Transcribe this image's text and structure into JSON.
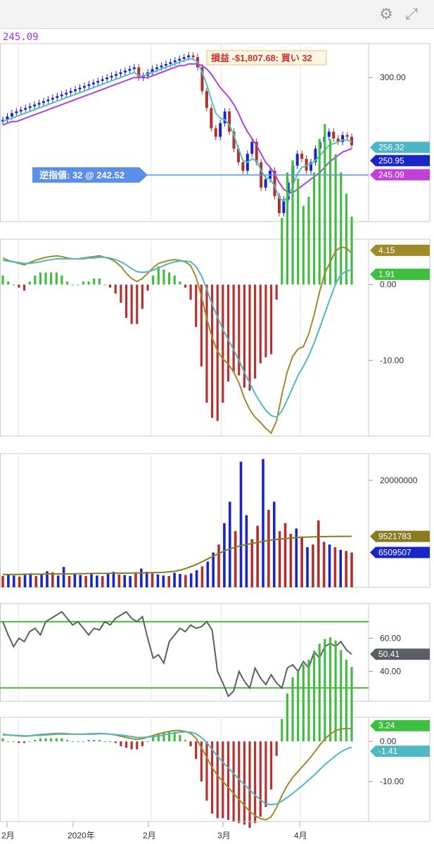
{
  "toolbar": {
    "settings_icon": "gear-icon",
    "expand_icon": "expand-icon"
  },
  "chart_data": [
    {
      "type": "candlestick",
      "panel": "price",
      "top_price_label": "245.09",
      "axis_ticks": [
        "300.00"
      ],
      "price_tags": [
        {
          "text": "256.32",
          "color": "#4db6c6",
          "value": 256.32
        },
        {
          "text": "250.95",
          "color": "#1a25c8",
          "value": 250.95
        },
        {
          "text": "245.09",
          "color": "#c040d8",
          "value": 245.09
        }
      ],
      "pnl_label": "損益 -$1,807.68: 買い 32",
      "stop_order": {
        "text": "逆指値: 32 @ 242.52",
        "value": 242.52
      },
      "ylim": [
        215,
        320
      ],
      "close": [
        275,
        277,
        279,
        280,
        281,
        282,
        283,
        284,
        285,
        286,
        287,
        288,
        289,
        290,
        291,
        292,
        293,
        294,
        295,
        296,
        297,
        298,
        299,
        300,
        301,
        302,
        303,
        304,
        305,
        306,
        300,
        301,
        303,
        305,
        306,
        307,
        308,
        309,
        310,
        311,
        312,
        313,
        312,
        306,
        292,
        282,
        270,
        265,
        273,
        280,
        268,
        258,
        250,
        245,
        255,
        262,
        250,
        235,
        240,
        245,
        230,
        220,
        228,
        238,
        248,
        255,
        252,
        245,
        250,
        258,
        262,
        265,
        268,
        264,
        262,
        266,
        265,
        260
      ],
      "series": [
        {
          "name": "MA short",
          "color": "#55c0c2",
          "values": [
            274,
            275,
            276,
            277,
            278,
            279,
            280,
            281,
            282,
            283,
            284,
            285,
            286,
            287,
            288,
            289,
            290,
            291,
            292,
            293,
            294,
            295,
            296,
            297,
            298,
            299,
            300,
            301,
            302,
            303,
            301,
            301,
            302,
            303,
            304,
            305,
            306,
            307,
            308,
            309,
            310,
            311,
            311,
            309,
            303,
            296,
            287,
            279,
            276,
            275,
            272,
            266,
            258,
            251,
            250,
            252,
            251,
            245,
            241,
            240,
            236,
            229,
            227,
            230,
            236,
            243,
            247,
            248,
            249,
            251,
            254,
            257,
            260,
            261,
            262,
            263,
            263,
            262
          ]
        },
        {
          "name": "MA long",
          "color": "#b040e0",
          "values": [
            272,
            273,
            274,
            274,
            275,
            276,
            277,
            278,
            279,
            280,
            281,
            282,
            283,
            284,
            285,
            286,
            287,
            288,
            289,
            290,
            291,
            292,
            293,
            294,
            295,
            296,
            297,
            298,
            299,
            300,
            300,
            300,
            300,
            301,
            302,
            303,
            304,
            305,
            306,
            307,
            307,
            308,
            308,
            308,
            307,
            305,
            302,
            298,
            294,
            291,
            288,
            284,
            279,
            273,
            268,
            264,
            260,
            255,
            250,
            247,
            243,
            238,
            234,
            232,
            232,
            234,
            236,
            238,
            240,
            242,
            244,
            247,
            250,
            252,
            254,
            256,
            257,
            258
          ]
        }
      ]
    },
    {
      "type": "histogram+line",
      "panel": "macd",
      "axis_ticks": [
        "0.00",
        "-10.00"
      ],
      "tags": [
        {
          "text": "4.15",
          "color": "#a08a2a",
          "value": 4.15
        },
        {
          "text": "1.91",
          "color": "#3fbf3f",
          "value": 1.91
        }
      ],
      "ylim": [
        -20,
        6
      ],
      "series": [
        {
          "name": "MACD",
          "color": "#a08a2a",
          "values": [
            3.5,
            3.2,
            3.0,
            2.8,
            2.6,
            2.9,
            3.2,
            3.4,
            3.6,
            3.7,
            3.8,
            3.7,
            3.5,
            3.4,
            3.4,
            3.5,
            3.6,
            3.7,
            3.8,
            3.6,
            3.4,
            3.0,
            2.4,
            1.5,
            0.8,
            0.4,
            0.8,
            1.5,
            2.2,
            2.8,
            3.0,
            3.2,
            3.3,
            3.2,
            3.0,
            2.5,
            1.0,
            -1.5,
            -4.5,
            -7.0,
            -8.8,
            -9.8,
            -10.5,
            -11.5,
            -13.0,
            -15.0,
            -16.5,
            -17.5,
            -18.2,
            -19.0,
            -19.6,
            -18.0,
            -14.5,
            -11.5,
            -9.5,
            -8.5,
            -8.2,
            -6.5,
            -4.0,
            -1.0,
            1.5,
            3.0,
            4.4,
            5.0,
            4.8,
            4.15
          ]
        },
        {
          "name": "Signal",
          "color": "#4fb8c2",
          "values": [
            3.2,
            3.1,
            3.0,
            2.9,
            2.8,
            2.8,
            2.9,
            3.0,
            3.2,
            3.3,
            3.4,
            3.4,
            3.4,
            3.4,
            3.4,
            3.4,
            3.5,
            3.5,
            3.6,
            3.6,
            3.5,
            3.3,
            3.0,
            2.6,
            2.1,
            1.7,
            1.6,
            1.7,
            1.9,
            2.2,
            2.5,
            2.8,
            3.0,
            3.1,
            3.1,
            3.0,
            2.4,
            1.2,
            -0.6,
            -2.6,
            -4.3,
            -5.9,
            -7.3,
            -8.6,
            -10.0,
            -11.6,
            -13.0,
            -14.4,
            -15.6,
            -16.6,
            -17.3,
            -17.5,
            -16.7,
            -15.2,
            -13.6,
            -12.0,
            -10.8,
            -9.4,
            -7.7,
            -5.8,
            -3.8,
            -1.8,
            0.1,
            1.3,
            1.8,
            1.91
          ]
        }
      ]
    },
    {
      "type": "bar+line",
      "panel": "volume",
      "axis_ticks": [
        "20000000"
      ],
      "tags": [
        {
          "text": "9521783",
          "color": "#8a7a20",
          "value": 9521783
        },
        {
          "text": "6509507",
          "color": "#1a25c8",
          "value": 6509507
        }
      ],
      "ylim": [
        0,
        25000000
      ],
      "values": [
        2100000,
        2500000,
        2200000,
        2000000,
        2300000,
        2600000,
        2100000,
        2400000,
        3000000,
        2800000,
        2200000,
        3800000,
        2100000,
        2600000,
        2300000,
        2100000,
        2500000,
        2200000,
        2100000,
        2600000,
        2900000,
        2400000,
        2300000,
        2100000,
        2800000,
        3500000,
        2900000,
        2600000,
        2400000,
        2200000,
        2100000,
        2700000,
        2500000,
        2300000,
        2600000,
        3200000,
        3900000,
        4800000,
        6500000,
        8000000,
        12000000,
        16000000,
        10500000,
        23500000,
        13500000,
        9000000,
        11500000,
        24000000,
        14500000,
        16000000,
        10500000,
        12000000,
        10000000,
        11000000,
        9500000,
        7500000,
        8000000,
        12500000,
        8500000,
        8000000,
        7500000,
        7000000,
        6800000,
        6509507
      ],
      "colors_up_down": [
        "#1a25c8",
        "#b03030"
      ],
      "series": [
        {
          "name": "Volume MA",
          "color": "#8a7a20",
          "values": [
            2400000,
            2400000,
            2400000,
            2400000,
            2450000,
            2450000,
            2450000,
            2450000,
            2500000,
            2500000,
            2500000,
            2500000,
            2500000,
            2550000,
            2550000,
            2550000,
            2600000,
            2600000,
            2600000,
            2600000,
            2650000,
            2650000,
            2650000,
            2650000,
            2700000,
            2700000,
            2700000,
            2750000,
            2750000,
            2800000,
            2900000,
            3000000,
            3200000,
            3500000,
            3900000,
            4300000,
            4800000,
            5300000,
            5800000,
            6300000,
            6800000,
            7200000,
            7500000,
            7800000,
            8000000,
            8200000,
            8400000,
            8600000,
            8800000,
            8900000,
            9000000,
            9100000,
            9200000,
            9300000,
            9350000,
            9400000,
            9430000,
            9460000,
            9480000,
            9500000,
            9510000,
            9520000,
            9521783,
            9521783
          ]
        }
      ]
    },
    {
      "type": "line",
      "panel": "rsi",
      "axis_ticks": [
        "60.00",
        "40.00"
      ],
      "tags": [
        {
          "text": "50.41",
          "color": "#5a5f66",
          "value": 50.41
        }
      ],
      "ylim": [
        22,
        81
      ],
      "bands": [
        70,
        30
      ],
      "values": [
        70,
        62,
        55,
        60,
        58,
        64,
        66,
        62,
        70,
        72,
        74,
        76,
        72,
        68,
        70,
        66,
        62,
        66,
        65,
        70,
        68,
        72,
        74,
        76,
        72,
        70,
        73,
        60,
        48,
        50,
        45,
        58,
        62,
        66,
        64,
        68,
        66,
        67,
        70,
        65,
        40,
        33,
        25,
        28,
        40,
        34,
        30,
        42,
        36,
        32,
        38,
        33,
        30,
        42,
        44,
        40,
        46,
        42,
        52,
        48,
        55,
        57,
        55,
        58,
        53,
        50.41
      ]
    },
    {
      "type": "histogram+line",
      "panel": "macd2",
      "axis_ticks": [
        "0.00",
        "-10.00"
      ],
      "tags": [
        {
          "text": "3.24",
          "color": "#3fbf3f",
          "value": 3.24
        },
        {
          "text": "-1.41",
          "color": "#4fb8c2",
          "value": -1.41
        }
      ],
      "ylim": [
        -20,
        6
      ],
      "series": [
        {
          "name": "MACD",
          "color": "#a08a2a",
          "values": [
            1.8,
            1.6,
            1.5,
            1.4,
            1.3,
            1.4,
            1.6,
            1.7,
            1.8,
            1.9,
            2.0,
            2.0,
            1.9,
            1.8,
            1.8,
            1.8,
            1.9,
            1.9,
            2.0,
            1.9,
            1.8,
            1.6,
            1.3,
            1.0,
            0.7,
            0.5,
            0.7,
            1.1,
            1.5,
            1.9,
            2.2,
            2.5,
            2.7,
            2.7,
            2.5,
            2.0,
            0.8,
            -1.5,
            -4.0,
            -6.5,
            -8.5,
            -10.0,
            -11.5,
            -13.0,
            -14.5,
            -16.0,
            -17.5,
            -18.5,
            -19.3,
            -19.6,
            -18.8,
            -16.5,
            -13.5,
            -11.0,
            -9.0,
            -7.5,
            -6.0,
            -4.5,
            -2.8,
            -1.0,
            0.6,
            1.8,
            2.7,
            3.1,
            3.2,
            3.24
          ]
        },
        {
          "name": "Signal",
          "color": "#4fb8c2",
          "values": [
            1.6,
            1.6,
            1.5,
            1.5,
            1.4,
            1.4,
            1.5,
            1.5,
            1.6,
            1.7,
            1.8,
            1.8,
            1.8,
            1.8,
            1.8,
            1.8,
            1.8,
            1.8,
            1.9,
            1.9,
            1.8,
            1.7,
            1.6,
            1.4,
            1.2,
            1.0,
            1.0,
            1.1,
            1.2,
            1.4,
            1.6,
            1.9,
            2.1,
            2.3,
            2.4,
            2.3,
            1.9,
            1.0,
            -0.3,
            -2.0,
            -3.7,
            -5.2,
            -6.6,
            -8.0,
            -9.4,
            -10.8,
            -12.1,
            -13.4,
            -14.6,
            -15.5,
            -15.8,
            -15.6,
            -14.9,
            -14.0,
            -13.0,
            -11.9,
            -10.8,
            -9.6,
            -8.4,
            -7.1,
            -5.8,
            -4.7,
            -3.6,
            -2.6,
            -1.9,
            -1.41
          ]
        }
      ]
    }
  ],
  "x_axis": {
    "labels": [
      "2月",
      "2020年",
      "2月",
      "3月",
      "4月"
    ]
  }
}
